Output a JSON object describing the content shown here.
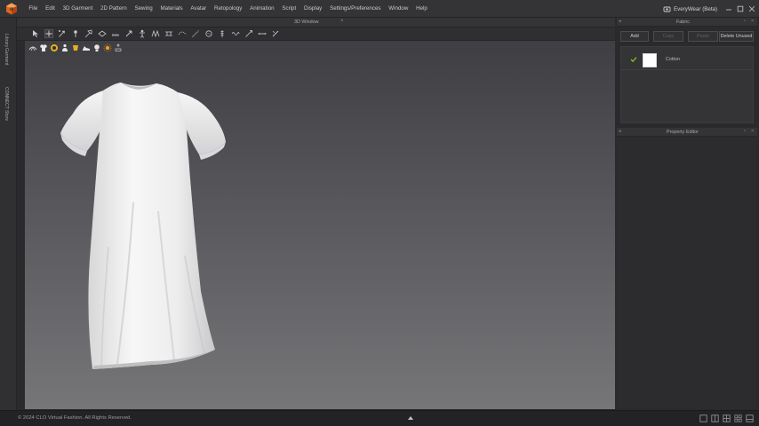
{
  "menu": {
    "items": [
      "File",
      "Edit",
      "3D Garment",
      "2D Pattern",
      "Sewing",
      "Materials",
      "Avatar",
      "Retopology",
      "Animation",
      "Script",
      "Display",
      "Settings/Preferences",
      "Window",
      "Help"
    ]
  },
  "user": {
    "label": "EveryWear (Beta)",
    "icon": "everywear-icon"
  },
  "left_tabs": {
    "library": "Library",
    "garment": "Garment",
    "connect": "CONNECT Store"
  },
  "viewport": {
    "title": "3D Window",
    "close": "×"
  },
  "fabric_panel": {
    "title": "Fabric",
    "buttons": {
      "add": "Add",
      "copy": "Copy",
      "paste": "Paste",
      "delete_unused": "Delete Unused"
    },
    "items": [
      {
        "name": "Cotton",
        "swatch_color": "#ffffff",
        "checked": true
      }
    ]
  },
  "property_panel": {
    "title": "Property Editor"
  },
  "status": {
    "copyright": "© 2024 CLO Virtual Fashion.  All Rights Reserved."
  },
  "colors": {
    "accent": "#e0641c",
    "check": "#8fc61a",
    "garment": "#f4f4f4"
  }
}
